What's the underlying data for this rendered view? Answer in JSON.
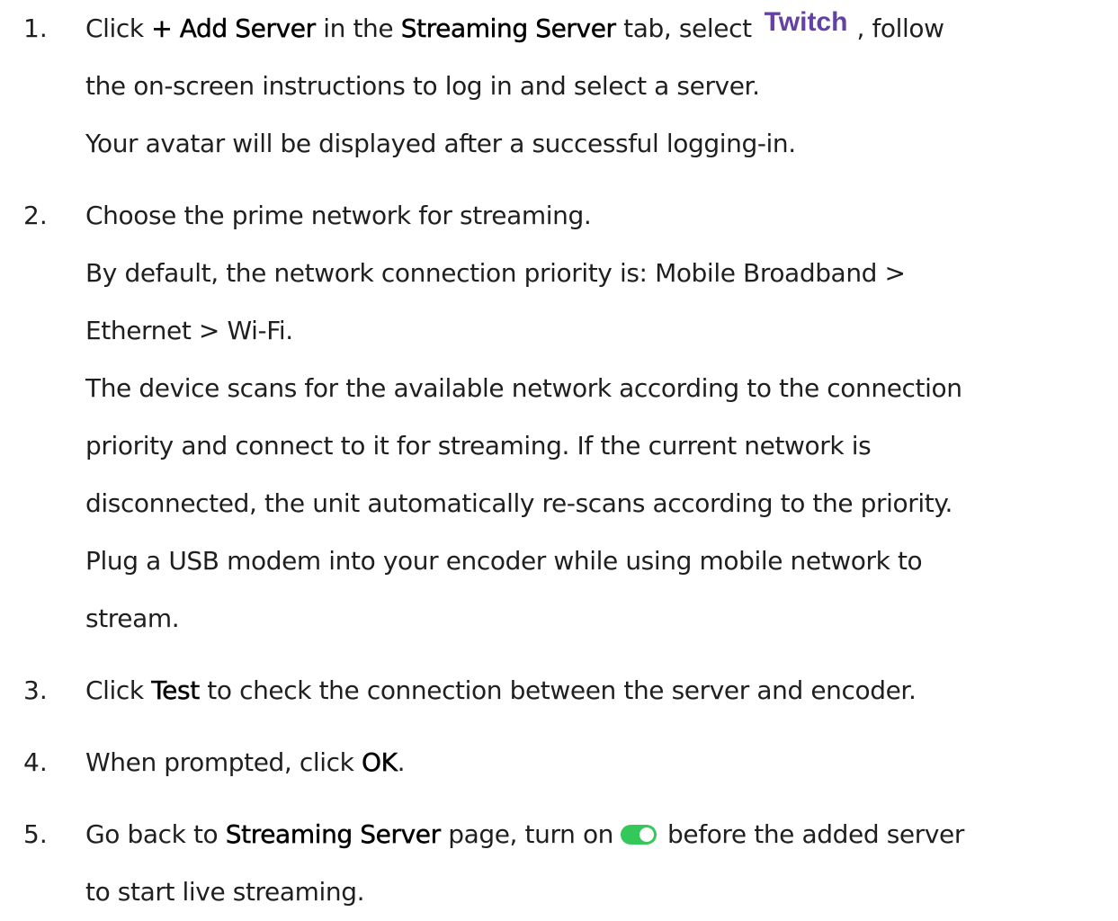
{
  "steps": [
    {
      "number": "1.",
      "l1_a": "Click ",
      "l1_b": "+ Add Server",
      "l1_c": " in the ",
      "l1_d": "Streaming Server",
      "l1_e": " tab, select",
      "twitch_logo": "Twitch",
      "l1_f": ", follow",
      "l2": "the on-screen instructions to log in and select a server.",
      "l3": "Your avatar will be displayed after a successful logging-in."
    },
    {
      "number": "2.",
      "l1": "Choose the prime network for streaming.",
      "l2": "By default, the network connection priority is: Mobile Broadband >",
      "l3": "Ethernet > Wi-Fi.",
      "l4": "The device scans for the available network according to the connection",
      "l5": "priority and connect to it for streaming. If the current network is",
      "l6": "disconnected, the unit automatically re-scans according to the priority.",
      "l7": "Plug a USB modem into your encoder while using mobile network to",
      "l8": "stream."
    },
    {
      "number": "3.",
      "l1_a": "Click ",
      "l1_b": "Test",
      "l1_c": " to check the connection between the server and encoder."
    },
    {
      "number": "4.",
      "l1_a": "When prompted, click ",
      "l1_b": "OK",
      "l1_c": "."
    },
    {
      "number": "5.",
      "l1_a": "Go back to ",
      "l1_b": "Streaming Server",
      "l1_c": " page, turn on",
      "toggle_icon": "toggle-on-icon",
      "l1_d": "before the added server",
      "l2": "to start live streaming."
    }
  ],
  "colors": {
    "twitch_brand": "#6441a4",
    "toggle_on": "#34c759",
    "text": "#1f1f1f"
  }
}
